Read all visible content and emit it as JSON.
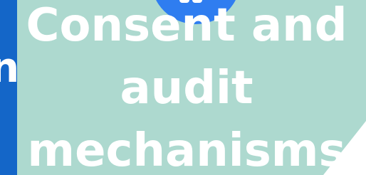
{
  "slide": {
    "title_lines": [
      "Consent and",
      "audit",
      "mechanisms"
    ],
    "edge_letter": "n"
  },
  "colors": {
    "card_background": "#add9cf",
    "left_bar": "#1466c8",
    "circle": "#2f7df0",
    "text": "#ffffff"
  }
}
